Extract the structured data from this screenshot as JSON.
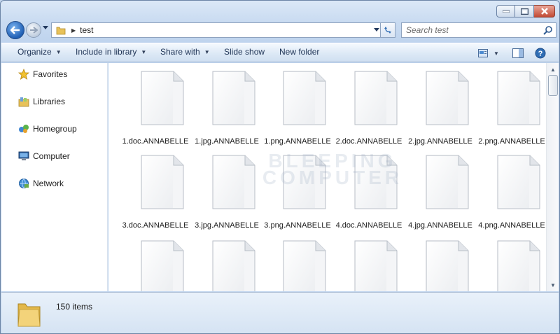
{
  "window": {
    "caption": {
      "minimize": "minimize",
      "maximize": "maximize",
      "close": "close"
    }
  },
  "address_bar": {
    "breadcrumb": "test",
    "search_placeholder": "Search test"
  },
  "command_bar": {
    "organize": "Organize",
    "include_in_library": "Include in library",
    "share_with": "Share with",
    "slide_show": "Slide show",
    "new_folder": "New folder"
  },
  "sidebar": {
    "items": [
      {
        "label": "Favorites",
        "icon": "star-icon"
      },
      {
        "label": "Libraries",
        "icon": "libraries-icon"
      },
      {
        "label": "Homegroup",
        "icon": "homegroup-icon"
      },
      {
        "label": "Computer",
        "icon": "computer-icon"
      },
      {
        "label": "Network",
        "icon": "network-icon"
      }
    ]
  },
  "files": [
    {
      "name": "1.doc.ANNABELLE"
    },
    {
      "name": "1.jpg.ANNABELLE"
    },
    {
      "name": "1.png.ANNABELLE"
    },
    {
      "name": "2.doc.ANNABELLE"
    },
    {
      "name": "2.jpg.ANNABELLE"
    },
    {
      "name": "2.png.ANNABELLE"
    },
    {
      "name": "3.doc.ANNABELLE"
    },
    {
      "name": "3.jpg.ANNABELLE"
    },
    {
      "name": "3.png.ANNABELLE"
    },
    {
      "name": "4.doc.ANNABELLE"
    },
    {
      "name": "4.jpg.ANNABELLE"
    },
    {
      "name": "4.png.ANNABELLE"
    },
    {
      "name": ""
    },
    {
      "name": ""
    },
    {
      "name": ""
    },
    {
      "name": ""
    },
    {
      "name": ""
    },
    {
      "name": ""
    }
  ],
  "watermark": {
    "line1": "BLEEPING",
    "line2": "COMPUTER"
  },
  "details_pane": {
    "item_count": "150 items"
  },
  "colors": {
    "accent": "#2f6db4",
    "close_button": "#c24a34",
    "frame": "#c9dbf1"
  }
}
